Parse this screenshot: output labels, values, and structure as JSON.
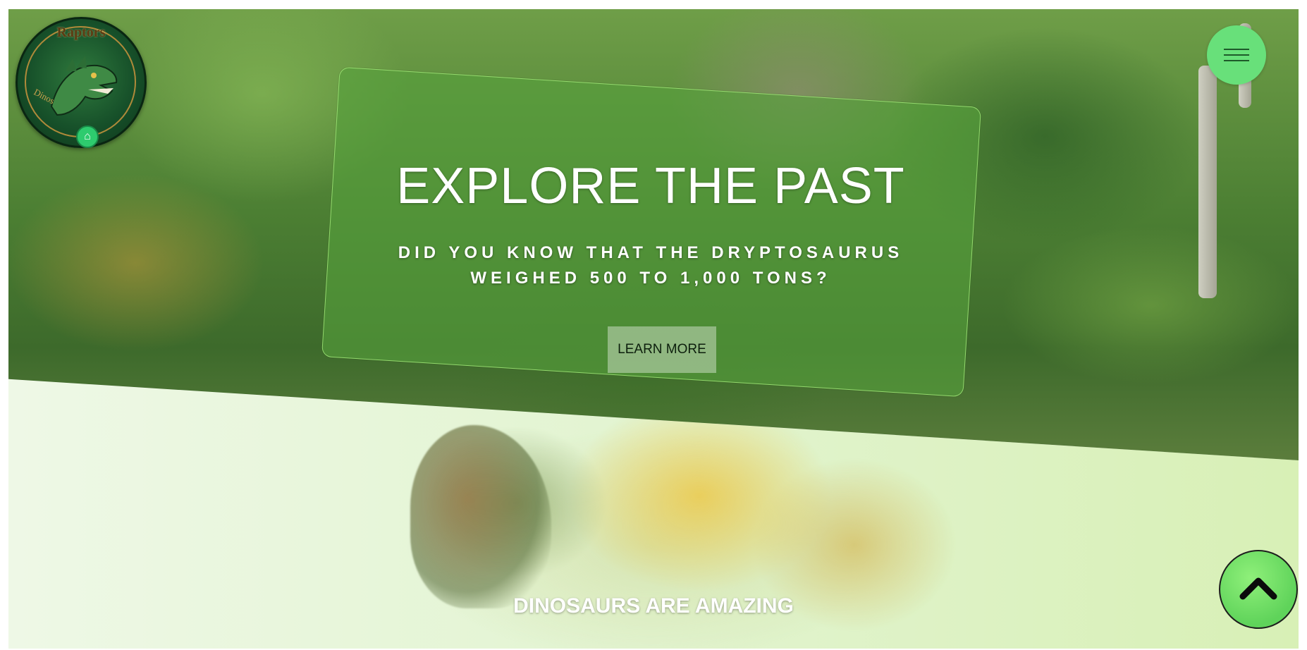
{
  "logo": {
    "title": "Raptors",
    "subtitle": "Dinos",
    "icon": "dragon-head-icon",
    "badge_icon": "home-icon"
  },
  "menu": {
    "icon": "hamburger-icon"
  },
  "hero": {
    "title": "EXPLORE THE PAST",
    "subtitle": "DID YOU KNOW THAT THE DRYPTOSAURUS WEIGHED 500 TO 1,000 TONS?",
    "cta_label": "LEARN MORE"
  },
  "section": {
    "title": "DINOSAURS ARE AMAZING"
  },
  "back_to_top": {
    "icon": "chevron-up-icon"
  },
  "colors": {
    "accent": "#68e07a",
    "card": "#55a03c",
    "lower_bg": "#e2f4d0"
  }
}
